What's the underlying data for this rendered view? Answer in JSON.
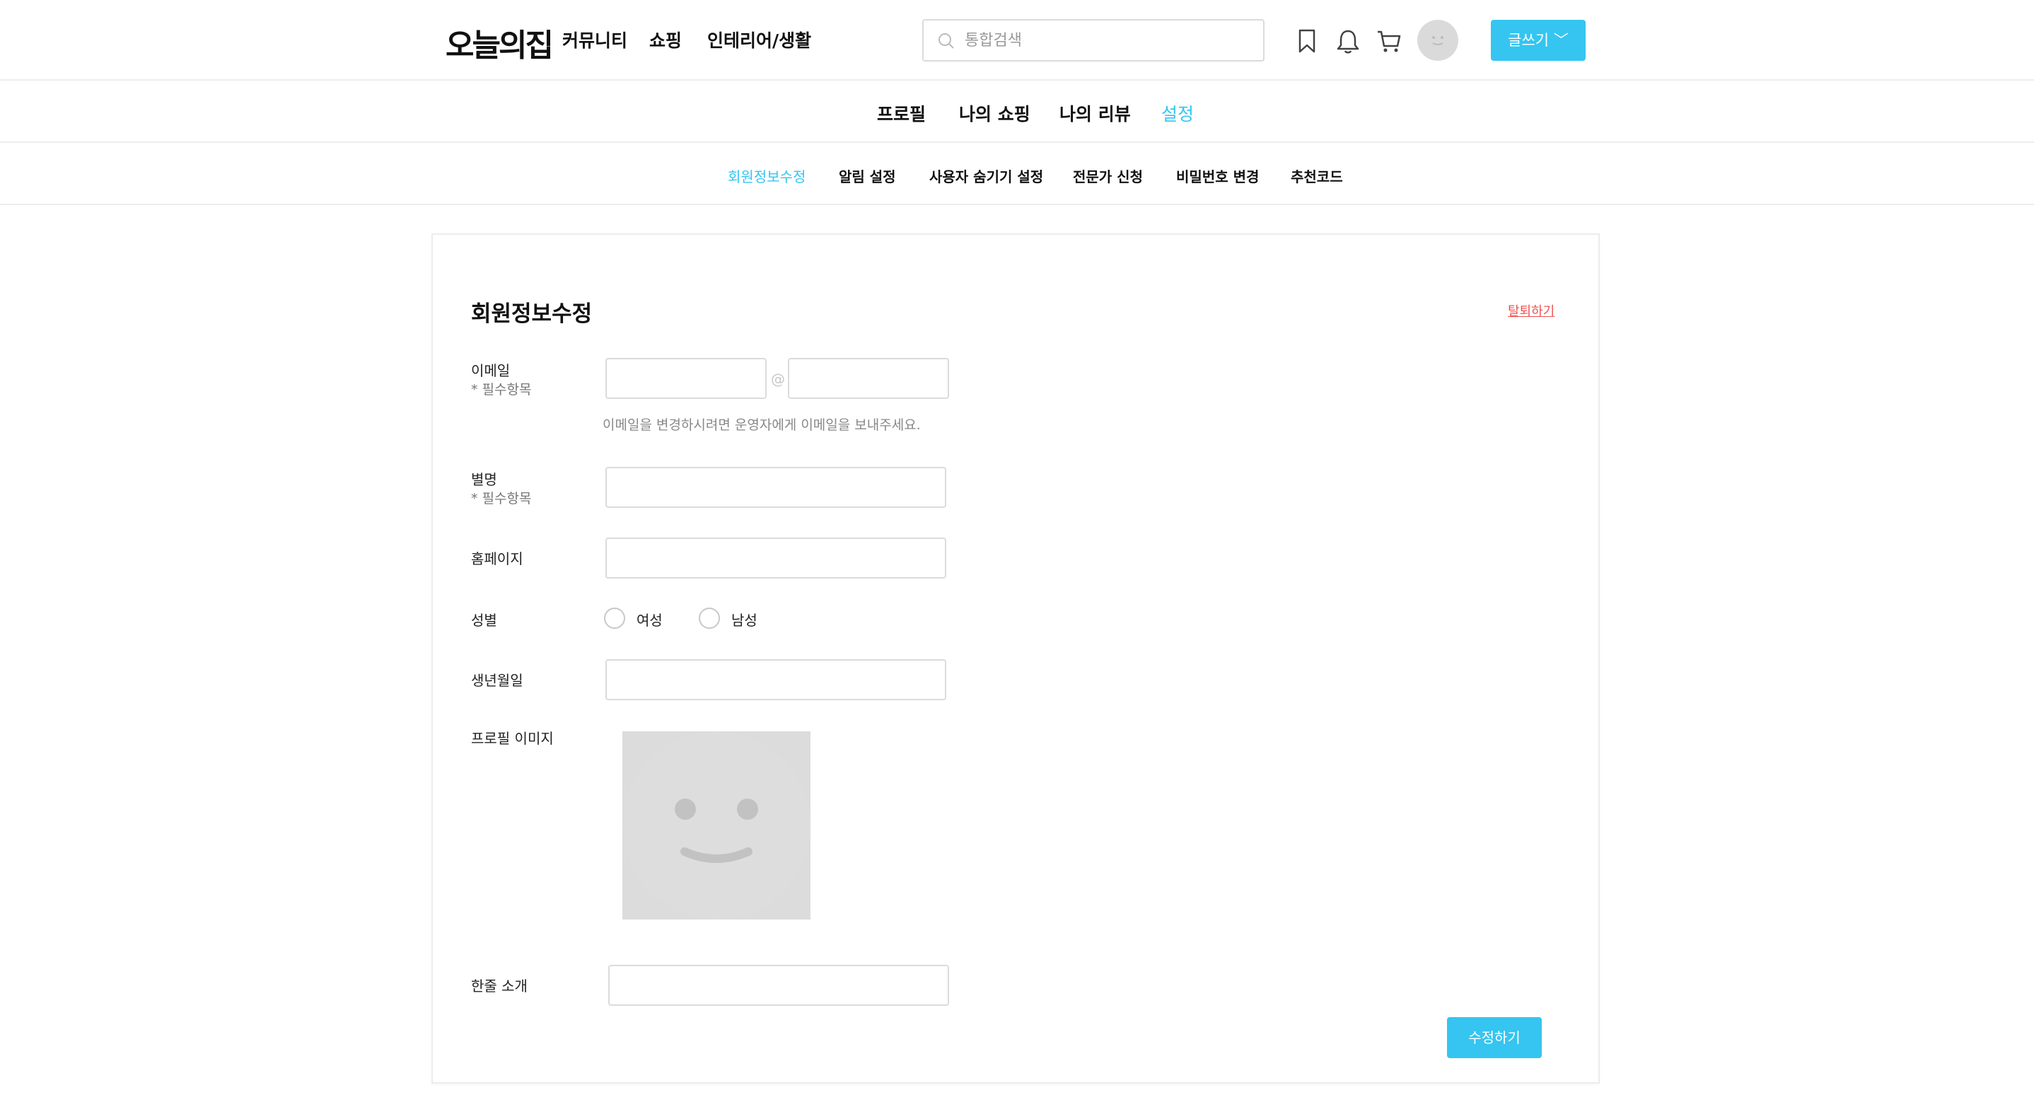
{
  "header": {
    "logo": "오늘의집",
    "nav": [
      "커뮤니티",
      "쇼핑",
      "인테리어/생활"
    ],
    "search_placeholder": "통합검색",
    "icons": [
      "bookmark-icon",
      "bell-icon",
      "cart-icon",
      "avatar"
    ],
    "write_label": "글쓰기 ﹀"
  },
  "section_nav": {
    "items": [
      "프로필",
      "나의 쇼핑",
      "나의 리뷰",
      "설정"
    ],
    "active": "설정"
  },
  "settings_nav": {
    "items": [
      "회원정보수정",
      "알림 설정",
      "사용자 숨기기 설정",
      "전문가 신청",
      "비밀번호 변경",
      "추천코드"
    ],
    "active": "회원정보수정"
  },
  "form": {
    "title": "회원정보수정",
    "withdraw_label": "탈퇴하기",
    "email_label": "이메일",
    "required_mark": "* 필수항목",
    "at_sign": "@",
    "email_help": "이메일을 변경하시려면 운영자에게 이메일을 보내주세요.",
    "nickname_label": "별명",
    "homepage_label": "홈페이지",
    "gender_label": "성별",
    "gender_options": [
      "여성",
      "남성"
    ],
    "birthday_label": "생년월일",
    "profile_image_label": "프로필 이미지",
    "intro_label": "한줄 소개",
    "submit_label": "수정하기"
  },
  "colors": {
    "accent": "#35c5f0",
    "danger": "#f05050",
    "border": "#dbdbdb",
    "placeholder_bg": "#dcdcdc"
  }
}
